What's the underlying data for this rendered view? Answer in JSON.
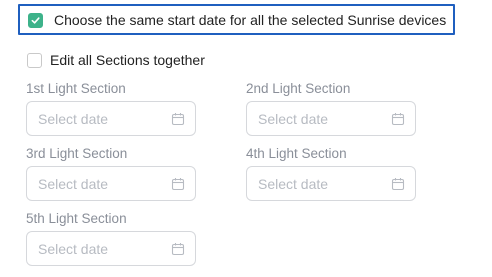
{
  "options": {
    "same_start_date": {
      "label": "Choose the same start date for all the selected Sunrise devices",
      "checked": true
    },
    "edit_all_sections": {
      "label": "Edit all Sections together",
      "checked": false
    }
  },
  "sections": [
    {
      "label": "1st Light Section",
      "placeholder": "Select date"
    },
    {
      "label": "2nd Light Section",
      "placeholder": "Select date"
    },
    {
      "label": "3rd Light Section",
      "placeholder": "Select date"
    },
    {
      "label": "4th Light Section",
      "placeholder": "Select date"
    },
    {
      "label": "5th Light Section",
      "placeholder": "Select date"
    }
  ],
  "colors": {
    "accent": "#3db28a",
    "highlight_border": "#1f5fbf",
    "label_gray": "#8a8f99",
    "placeholder_gray": "#b7bbc2"
  },
  "icons": {
    "checkbox_checked": "checkmark-icon",
    "date_field": "calendar-icon"
  }
}
